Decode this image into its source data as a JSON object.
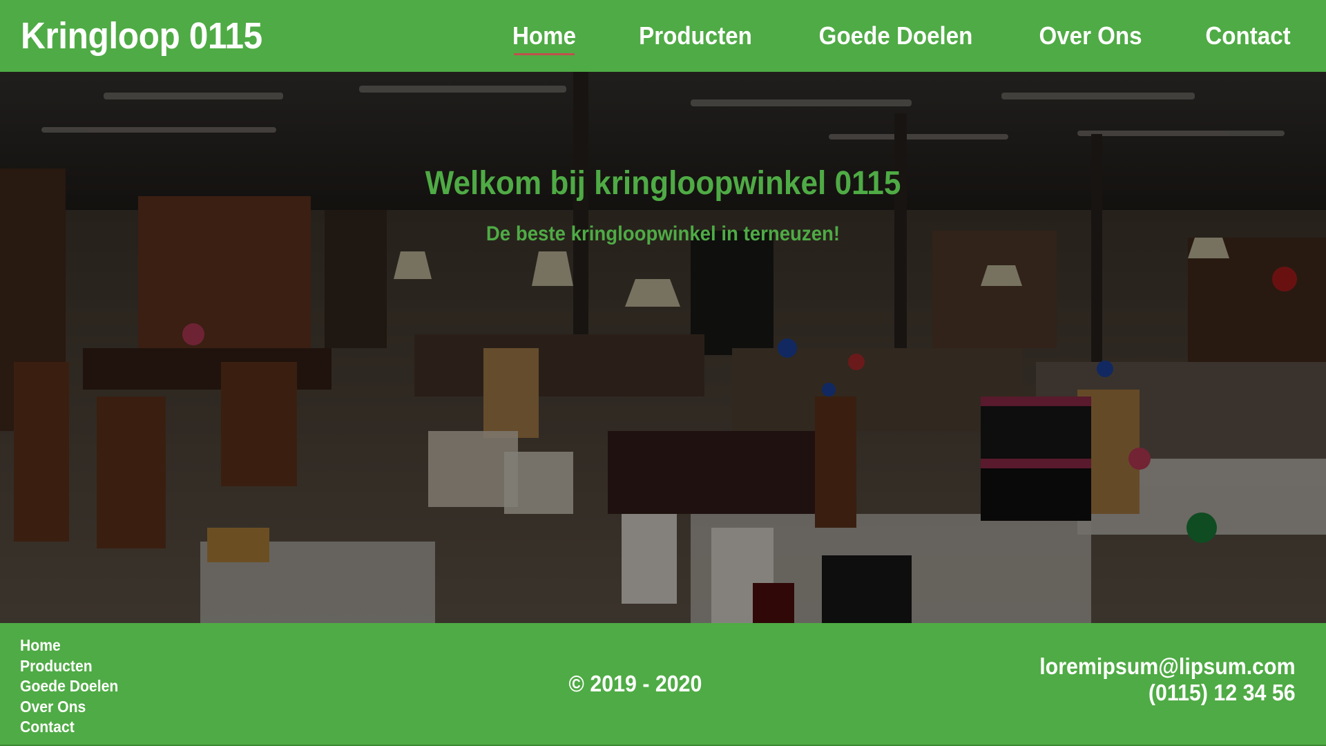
{
  "header": {
    "brand": "Kringloop 0115",
    "nav": [
      "Home",
      "Producten",
      "Goede Doelen",
      "Over Ons",
      "Contact"
    ],
    "active": "Home"
  },
  "hero": {
    "title": "Welkom bij kringloopwinkel 0115",
    "subtitle": "De beste kringloopwinkel in terneuzen!"
  },
  "footer": {
    "links": [
      "Home",
      "Producten",
      "Goede Doelen",
      "Over Ons",
      "Contact"
    ],
    "copyright": "© 2019 - 2020",
    "email": "loremipsum@lipsum.com",
    "phone": "(0115) 12 34 56"
  },
  "colors": {
    "brand_green": "#4fab45",
    "active_underline": "#c0504d"
  },
  "icons": {
    "hero_image": "secondhand-store-interior-photo"
  }
}
